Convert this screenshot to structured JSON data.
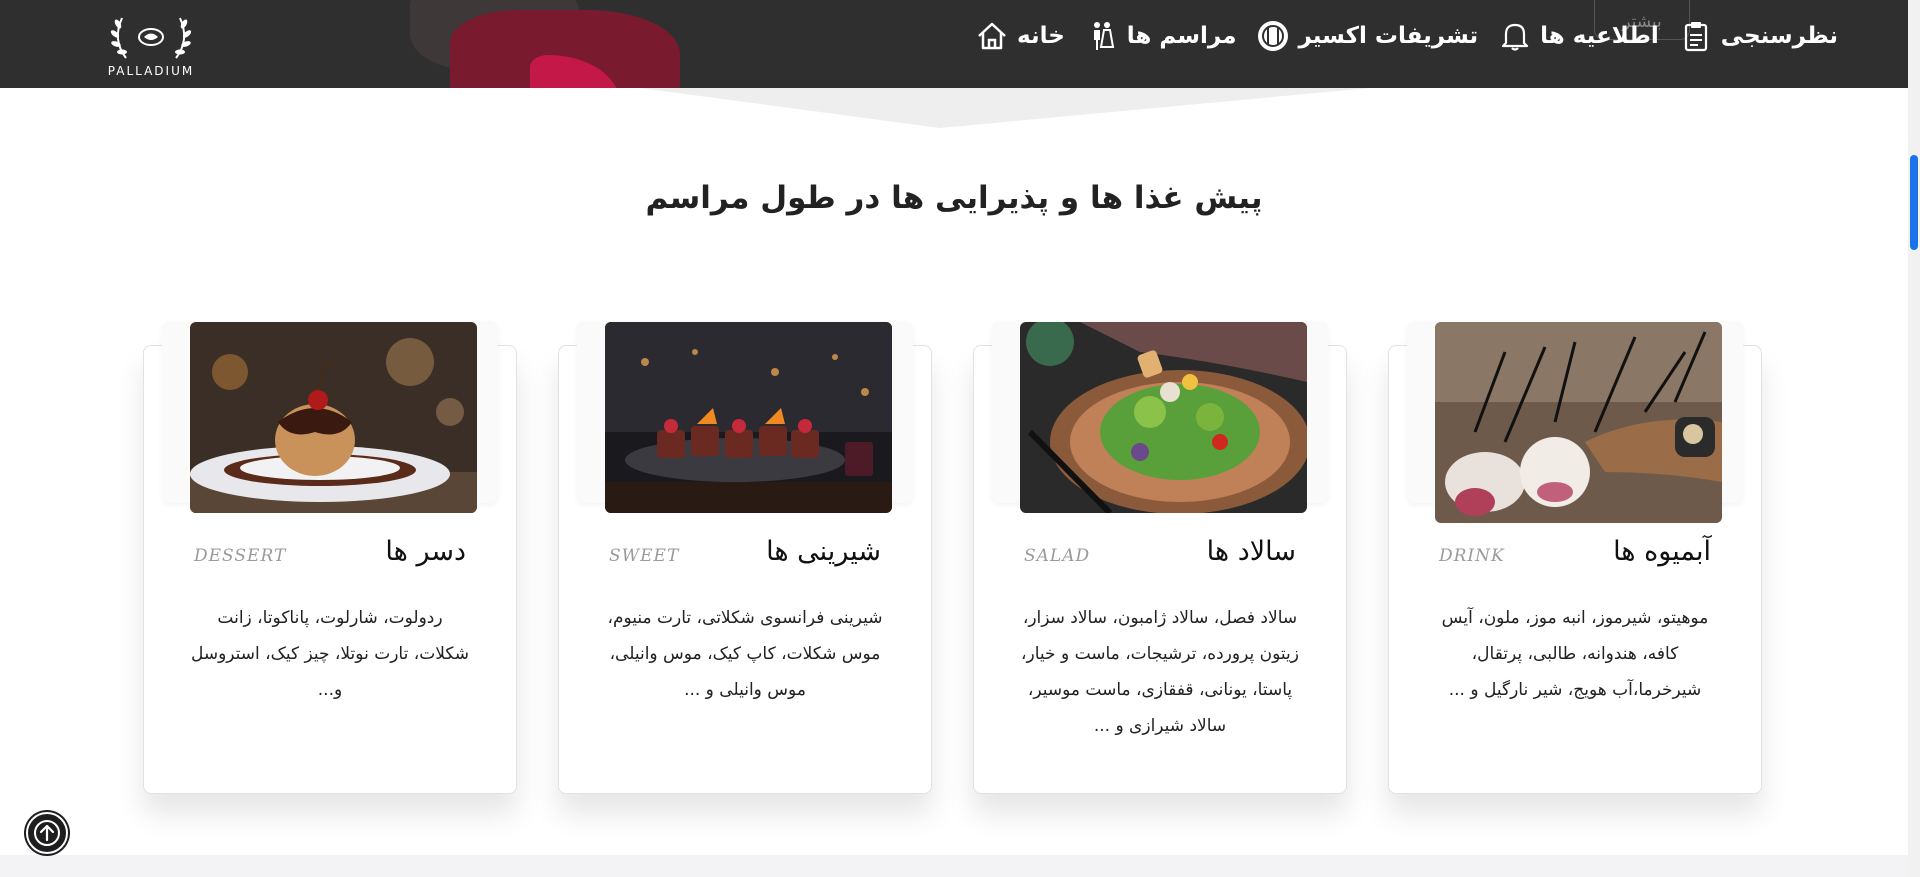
{
  "nav": {
    "logo_text": "PALLADIUM",
    "ghost_button_label": "بیشتر",
    "items": [
      {
        "label": "خانه",
        "icon": "home-icon"
      },
      {
        "label": "مراسم ها",
        "icon": "couple-icon"
      },
      {
        "label": "تشریفات اکسیر",
        "icon": "dining-icon"
      },
      {
        "label": "اطلاعیه ها",
        "icon": "bell-icon"
      },
      {
        "label": "نظرسنجی",
        "icon": "clipboard-icon"
      }
    ]
  },
  "section": {
    "title": "پیش غذا ها و پذیرایی ها در طول مراسم"
  },
  "cards": [
    {
      "title": "آبمیوه ها",
      "en": "DRINK",
      "desc": "موهیتو، شیرموز، انبه موز، ملون، آیس کافه، هندوانه، طالبی، پرتقال، شیرخرما،آب هویج، شیر نارگیل و ..."
    },
    {
      "title": "سالاد ها",
      "en": "SALAD",
      "desc": "سالاد فصل، سالاد ژامبون، سالاد سزار، زیتون پرورده، ترشیجات، ماست و خیار، پاستا، یونانی، قفقازی، ماست موسیر، سالاد شیرازی و ..."
    },
    {
      "title": "شیرینی ها",
      "en": "SWEET",
      "desc": "شیرینی فرانسوی شکلاتی، تارت منیوم، موس شکلات، کاپ کیک، موس وانیلی، موس وانیلی و ..."
    },
    {
      "title": "دسر ها",
      "en": "DESSERT",
      "desc": "ردولوت، شارلوت، پاناکوتا، زانت شکلات، تارت نوتلا، چیز کیک، استروسل و..."
    }
  ],
  "colors": {
    "navbar": "#2f2f2f",
    "accent": "#1a73e8"
  }
}
